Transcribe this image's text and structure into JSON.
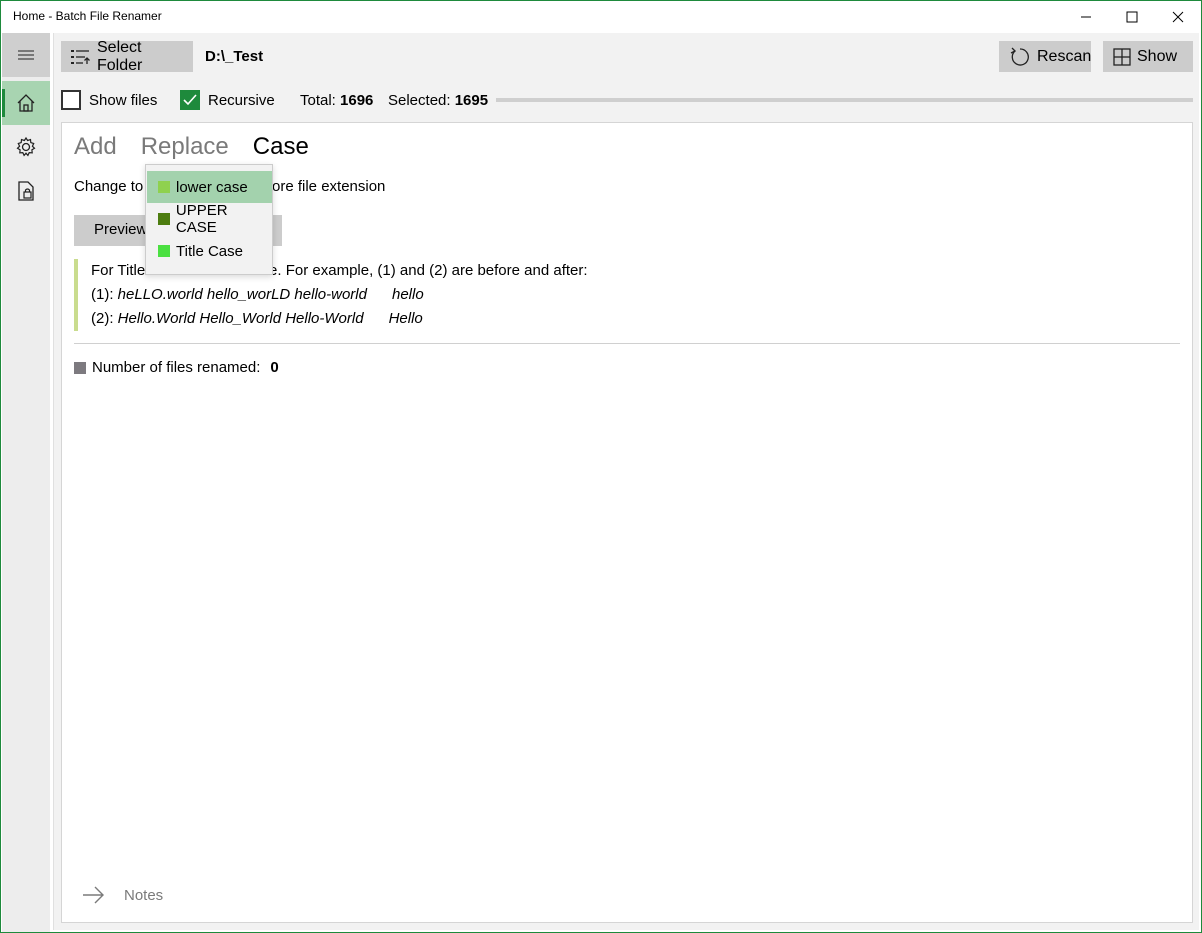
{
  "window": {
    "title": "Home - Batch File Renamer"
  },
  "toolbar": {
    "select_folder_label": "Select Folder",
    "folder_path": "D:\\_Test",
    "rescan_label": "Rescan",
    "show_label": "Show"
  },
  "options": {
    "show_files_label": "Show files",
    "show_files_checked": false,
    "recursive_label": "Recursive",
    "recursive_checked": true,
    "total_label": "Total:",
    "total_value": "1696",
    "selected_label": "Selected:",
    "selected_value": "1695"
  },
  "tabs": [
    {
      "label": "Add",
      "active": false
    },
    {
      "label": "Replace",
      "active": false
    },
    {
      "label": "Case",
      "active": true
    }
  ],
  "case_panel": {
    "change_to_label": "Change to",
    "extension_text": "ore file extension",
    "preview_label": "Preview",
    "info_line1_a": "For Title",
    "info_line1_b": "r the rule. For example, (1) and (2) are before and after:",
    "example1_prefix": "(1): ",
    "example1_text": "heLLO.world hello_worLD hello-world      hello",
    "example2_prefix": "(2): ",
    "example2_text": "Hello.World Hello_World Hello-World      Hello",
    "renamed_label": "Number of files renamed:",
    "renamed_value": "0"
  },
  "dropdown": {
    "items": [
      {
        "label": "lower case",
        "color": "#8fd14f",
        "selected": true
      },
      {
        "label": "UPPER CASE",
        "color": "#4d7d10",
        "selected": false
      },
      {
        "label": "Title Case",
        "color": "#4be041",
        "selected": false
      }
    ]
  },
  "notes": {
    "label": "Notes"
  },
  "colors": {
    "accent": "#1e8a3c",
    "nav_selected": "#a8d4b1",
    "dropdown_selected": "#a3d2ad"
  }
}
